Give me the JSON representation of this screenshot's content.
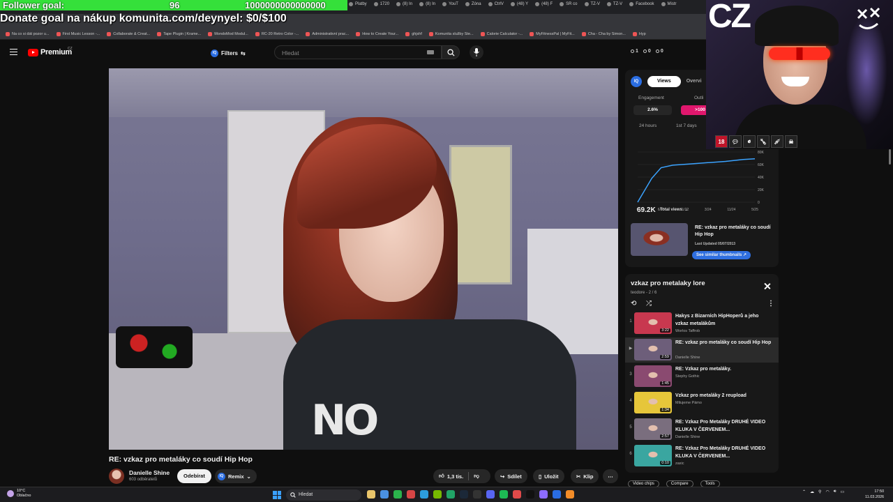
{
  "overlay": {
    "follower_label": "Follower goal:",
    "follower_count": "96",
    "follower_target": "1000000000000000",
    "donate_text": "Donate goal na nákup komunita.com/deynyel: $0/$100"
  },
  "browser": {
    "tabs": [
      "Platby",
      "1720",
      "(8) In",
      "(8) In",
      "YouT",
      "Zóna",
      "CtrlV",
      "(48) Y",
      "(48) F",
      "SR co",
      "TZ-V",
      "TZ-V",
      "Facebook",
      "Mistr"
    ],
    "bookmarks": [
      "Na co si dát pozor u...",
      "First Music Lesson -...",
      "Collaborate & Creat...",
      "Tape Plugin | Krame...",
      "MondoMod Modul...",
      "RC-20 Retro Color -...",
      "Administrativní prac...",
      "How to Create Your...",
      "ghjshf",
      "Komunita služby Ste...",
      "Calorie Calculator -...",
      "MyFitnessPal | MyFit...",
      "Cha - Cha by Simon...",
      "Hyp"
    ]
  },
  "header": {
    "logo_text": "Premium",
    "logo_country": "CZ",
    "filters_label": "Filters",
    "iq_badge": "IQ",
    "search_placeholder": "Hledat",
    "stats": [
      "1",
      "0",
      "0"
    ]
  },
  "video": {
    "shirt_text": "NO",
    "title": "RE: vzkaz pro metaláky co soudí Hip Hop",
    "channel": "Danielle Shine",
    "subscribers": "603 odběratelů",
    "subscribe_label": "Odebírat",
    "remix_label": "Remix",
    "likes": "1,3 tis.",
    "share_label": "Sdílet",
    "save_label": "Uložit",
    "clip_label": "Klip",
    "more_label": "⋯"
  },
  "iq_panel": {
    "badge": "IQ",
    "tab_views": "Views",
    "tab_overview": "Overvi",
    "engagement_label": "Engagement",
    "engagement_value": "2.6%",
    "outlier_label": "Outli",
    "outlier_value": ">100",
    "range_24h": "24 hours",
    "range_1st": "1st 7 days",
    "views_total": "69.2K",
    "views_dropdown": "Total views",
    "thumb_title": "RE: vzkaz pro metaláky co soudí Hip Hop",
    "thumb_updated": "Last Updated 05/07/2013",
    "similar_label": "See similar thumbnails"
  },
  "chart_data": {
    "type": "line",
    "title": "",
    "x": [
      "0",
      "6/20",
      "11/22",
      "3/24",
      "11/24",
      "5/25"
    ],
    "series": [
      {
        "values": [
          0,
          38,
          55,
          59,
          61,
          63,
          65,
          68,
          69.2
        ]
      }
    ],
    "x_points": [
      0,
      0.12,
      0.2,
      0.3,
      0.45,
      0.6,
      0.75,
      0.9,
      1.0
    ],
    "yticks": [
      "80K",
      "60K",
      "40K",
      "20K",
      "0"
    ],
    "ylim": [
      0,
      80
    ],
    "grid": true
  },
  "playlist": {
    "title": "vzkaz pro metalaky lore",
    "subtitle": "teodore - 2 / 6",
    "items": [
      {
        "num": "1",
        "title": "Hakys z Bizarních HipHoperů a jeho vzkaz metalákům",
        "channel": "Worlos Taffrob",
        "duration": "3:22",
        "color": "#c8384f"
      },
      {
        "num": "▶",
        "title": "RE: vzkaz pro metaláky co soudí Hip Hop",
        "channel": "Danielle Shine",
        "duration": "2:59",
        "color": "#6d5e7a"
      },
      {
        "num": "3",
        "title": "RE: Vzkaz pro metaláky.",
        "channel": "Stephy Gothic",
        "duration": "1:45",
        "color": "#8a4a70"
      },
      {
        "num": "4",
        "title": "Vzkaz pro metaláky 2 reupload",
        "channel": "Milujeme Pámo",
        "duration": "1:34",
        "color": "#e6c63a"
      },
      {
        "num": "5",
        "title": "RE: Vzkaz Pro Metaláky DRUHÉ VIDEO KLUKA V ČERVENEM...",
        "channel": "Danielle Shine",
        "duration": "2:57",
        "color": "#7a6e7e"
      },
      {
        "num": "6",
        "title": "RE: Vzkaz Pro Metaláky DRUHÉ VIDEO KLUKA V ČERVENEM...",
        "channel": "zaxic",
        "duration": "0:10",
        "color": "#3aa6a0"
      }
    ],
    "below_labels": [
      "Video chips",
      "Compare",
      "Tools"
    ]
  },
  "webcam": {
    "overlay_text": "CZ",
    "badge_age": "18"
  },
  "taskbar": {
    "temperature": "10°C",
    "weather": "Oblačno",
    "search_placeholder": "Hledat",
    "time": "17:50",
    "date": "11.03.2026",
    "app_colors": [
      "#e9c46a",
      "#4a90e2",
      "#2bb24c",
      "#d64545",
      "#2d9cdb",
      "#76b900",
      "#21a366",
      "#1b2838",
      "#333333",
      "#5865f2",
      "#1db954",
      "#e04a4a",
      "#111111",
      "#8c6cff",
      "#2a6de2",
      "#f28c28"
    ]
  }
}
